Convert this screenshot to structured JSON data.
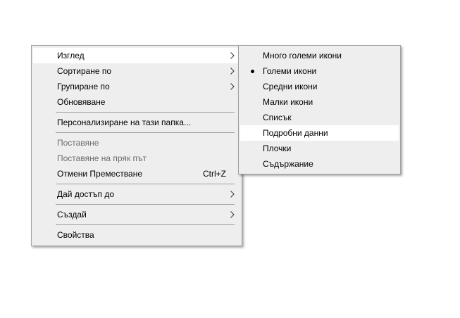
{
  "main_menu": {
    "view": "Изглед",
    "sort_by": "Сортиране по",
    "group_by": "Групиране по",
    "refresh": "Обновяване",
    "customize": "Персонализиране на тази папка...",
    "paste": "Поставяне",
    "paste_shortcut": "Поставяне на пряк път",
    "undo_move": "Отмени Преместване",
    "undo_shortcut": "Ctrl+Z",
    "give_access": "Дай достъп до",
    "new": "Създай",
    "properties": "Свойства"
  },
  "view_submenu": {
    "extra_large_icons": "Много големи икони",
    "large_icons": "Големи икони",
    "medium_icons": "Средни икони",
    "small_icons": "Малки икони",
    "list": "Списък",
    "details": "Подробни данни",
    "tiles": "Плочки",
    "content": "Съдържание"
  },
  "colors": {
    "menu_bg": "#eeeeee",
    "hover_bg": "#ffffff",
    "disabled_text": "#6d6d6d",
    "separator": "#a0a0a0"
  }
}
